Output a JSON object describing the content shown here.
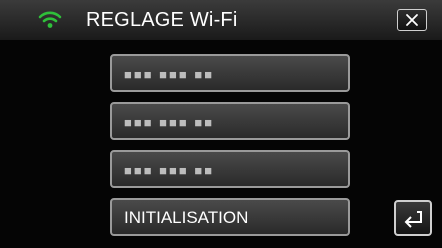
{
  "header": {
    "title": "REGLAGE Wi-Fi",
    "wifi_icon": "wifi-icon",
    "close_icon": "close-icon"
  },
  "items": [
    {
      "label": "■■■ ■■■ ■■",
      "masked": true
    },
    {
      "label": "■■■ ■■■ ■■",
      "masked": true
    },
    {
      "label": "■■■ ■■■ ■■",
      "masked": true
    },
    {
      "label": "INITIALISATION",
      "masked": false
    }
  ],
  "back_icon": "back-arrow-icon",
  "colors": {
    "wifi_green": "#2fbf3a",
    "button_border": "#9a9a9a",
    "header_bg": "#2a2a2a",
    "background": "#000000"
  }
}
